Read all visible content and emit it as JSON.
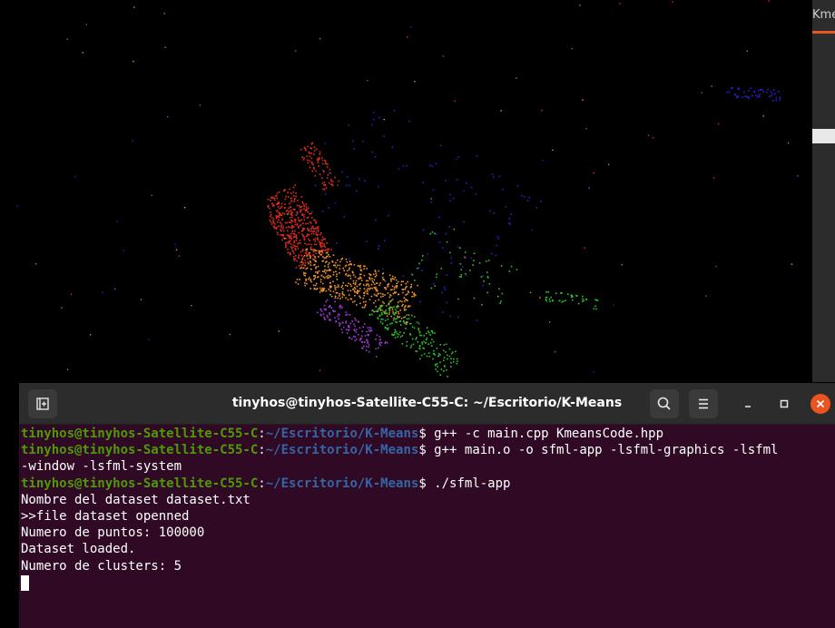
{
  "background_window": {
    "tab_title": "Kmea"
  },
  "terminal": {
    "title": "tinyhos@tinyhos-Satellite-C55-C: ~/Escritorio/K-Means",
    "prompt_user": "tinyhos@tinyhos-Satellite-C55-C",
    "prompt_sep": ":",
    "prompt_path": "~/Escritorio/K-Means",
    "prompt_end": "$ ",
    "commands": [
      "g++ -c main.cpp KmeansCode.hpp",
      "g++ main.o -o sfml-app -lsfml-graphics -lsfml",
      "./sfml-app"
    ],
    "wrap_line": "-window -lsfml-system",
    "output_lines": [
      "Nombre del dataset dataset.txt",
      ">>file dataset openned",
      "Numero de puntos: 100000",
      "Dataset loaded.",
      "Numero de clusters: 5"
    ],
    "colors": {
      "background": "#300a24",
      "user": "#4e9a06",
      "path": "#3465a4",
      "close": "#e95420"
    }
  },
  "scatter": {
    "clusters": [
      {
        "color": "#e32b1e"
      },
      {
        "color": "#f0922c"
      },
      {
        "color": "#a33ad4"
      },
      {
        "color": "#2bc42b"
      },
      {
        "color": "#2322d0"
      }
    ]
  },
  "icons": {
    "new_tab": "new-tab-icon",
    "search": "search-icon",
    "menu": "hamburger-menu-icon",
    "minimize": "minimize-icon",
    "maximize": "maximize-icon",
    "close": "close-icon"
  }
}
